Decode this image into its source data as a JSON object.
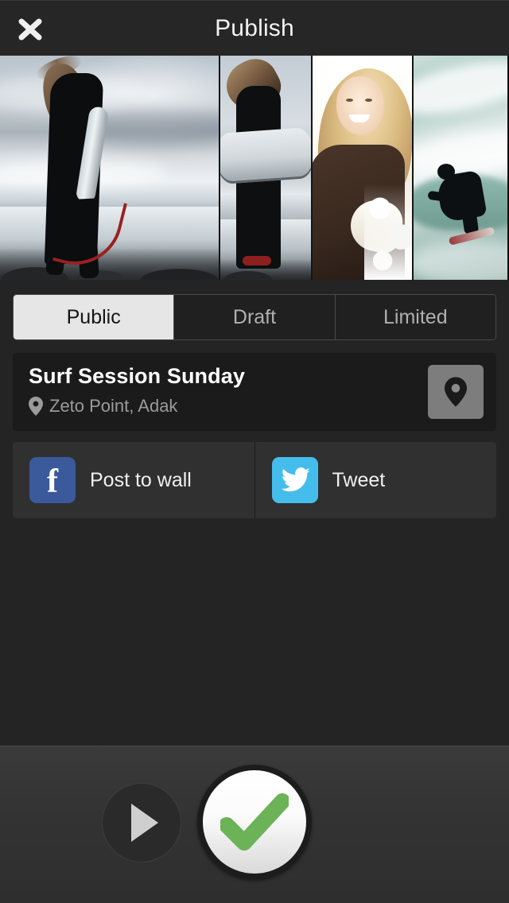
{
  "header": {
    "title": "Publish",
    "close_icon": "close-icon"
  },
  "photos": [
    {
      "alt": "Surfer walking into the ocean at dusk holding a board"
    },
    {
      "alt": "Surfer from behind carrying a white surfboard"
    },
    {
      "alt": "Blonde woman smiling in bright backlit sun"
    },
    {
      "alt": "Surfer riding a breaking teal wave"
    }
  ],
  "visibility": {
    "options": [
      "Public",
      "Draft",
      "Limited"
    ],
    "selected": "Public",
    "selected_index": 0
  },
  "post": {
    "title": "Surf Session Sunday",
    "location": "Zeto Point, Adak",
    "location_icon": "map-pin-icon",
    "map_button_icon": "map-pin-icon"
  },
  "share": [
    {
      "network": "facebook",
      "label": "Post to wall",
      "icon": "facebook-icon",
      "color": "#3b5a9b",
      "glyph": "f"
    },
    {
      "network": "twitter",
      "label": "Tweet",
      "icon": "twitter-icon",
      "color": "#45bdec"
    }
  ],
  "actions": {
    "play_icon": "play-icon",
    "confirm_icon": "check-icon",
    "confirm_color": "#6cb257"
  },
  "colors": {
    "background": "#242424",
    "header": "#262626",
    "card": "#1b1b1b",
    "social_row": "#303030",
    "segment_active_bg": "#e6e6e6",
    "accent_green": "#6cb257"
  }
}
